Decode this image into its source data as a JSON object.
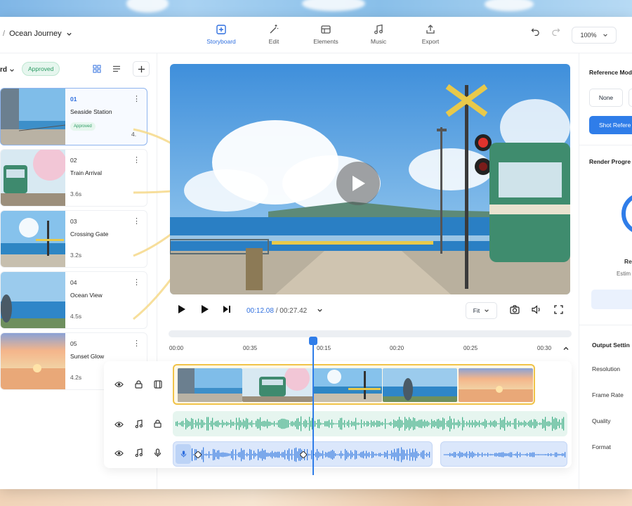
{
  "header": {
    "separator": "/",
    "project_name": "Ocean Journey",
    "tabs": [
      {
        "label": "Storyboard",
        "icon": "storyboard-icon",
        "active": true
      },
      {
        "label": "Edit",
        "icon": "magic-wand-icon",
        "active": false
      },
      {
        "label": "Elements",
        "icon": "elements-icon",
        "active": false
      },
      {
        "label": "Music",
        "icon": "music-note-icon",
        "active": false
      },
      {
        "label": "Export",
        "icon": "export-icon",
        "active": false
      }
    ],
    "zoom": "100%"
  },
  "storyboard": {
    "title_fragment": "rd",
    "status": "Approved",
    "shots": [
      {
        "number": "01",
        "name": "Seaside Station",
        "badge": "Approved",
        "duration": "4.",
        "selected": true
      },
      {
        "number": "02",
        "name": "Train Arrival",
        "duration": "3.6s"
      },
      {
        "number": "03",
        "name": "Crossing Gate",
        "duration": "3.2s"
      },
      {
        "number": "04",
        "name": "Ocean View",
        "duration": "4.5s"
      },
      {
        "number": "05",
        "name": "Sunset Glow",
        "duration": "4.2s"
      }
    ]
  },
  "player": {
    "current_time": "00:12.08",
    "separator": "/",
    "total_time": "00:27.42",
    "fit": "Fit"
  },
  "timeline": {
    "ticks": [
      "00:00",
      "00:35",
      "00:15",
      "00:20",
      "00:25",
      "00:30"
    ],
    "playhead_fraction": 0.36
  },
  "right_panel": {
    "reference_heading": "Reference Mod",
    "none_label": "None",
    "shot_ref_label": "Shot Refere",
    "render_heading": "Render Progre",
    "render_status_fragment": "Re",
    "estimate_fragment": "Estim",
    "output_heading": "Output Settin",
    "settings": [
      "Resolution",
      "Frame Rate",
      "Quality",
      "Format"
    ]
  },
  "colors": {
    "accent": "#2f7de9",
    "approved": "#2a9a62",
    "clip_border": "#f0c349"
  }
}
